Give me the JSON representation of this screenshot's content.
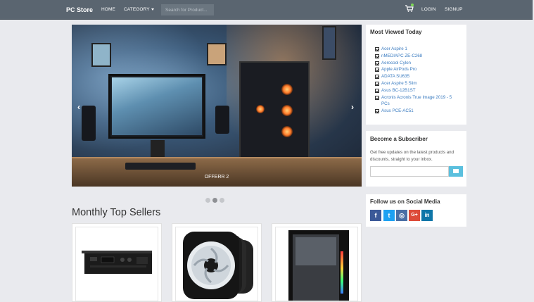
{
  "navbar": {
    "brand": "PC Store",
    "home": "HOME",
    "category": "CATEGORY",
    "search_placeholder": "Search for Product...",
    "login": "LOGIN",
    "signup": "SIGNUP",
    "cart_icon": "cart-icon"
  },
  "carousel": {
    "caption": "OFFERR 2",
    "prev_icon": "chevron-left-icon",
    "next_icon": "chevron-right-icon",
    "slides": 3,
    "active_slide": 2
  },
  "most_viewed": {
    "title": "Most Viewed Today",
    "items": [
      "Acer Aspire 1",
      "nMEDIAPC ZE-C268",
      "Aerocool Cylon",
      "Apple AirPods Pro",
      "ADATA SU635",
      "Acer Aspire 5 Slim",
      "Asus BC-12B1ST",
      "Acronis Acronis True Image 2019 - 5",
      "PCs",
      "Asus PCE-AC51"
    ]
  },
  "subscriber": {
    "title": "Become a Subscriber",
    "text": "Get free updates on the latest products and discounts, straight to your inbox.",
    "button_icon": "envelope-icon"
  },
  "social": {
    "title": "Follow us on Social Media",
    "icons": [
      {
        "name": "facebook-icon",
        "glyph": "f",
        "color": "#3b5998"
      },
      {
        "name": "twitter-icon",
        "glyph": "t",
        "color": "#1da1f2"
      },
      {
        "name": "instagram-icon",
        "glyph": "◎",
        "color": "#4a6fa5"
      },
      {
        "name": "google-plus-icon",
        "glyph": "G+",
        "color": "#dd4b39"
      },
      {
        "name": "linkedin-icon",
        "glyph": "in",
        "color": "#0e76a8"
      }
    ]
  },
  "monthly": {
    "title": "Monthly Top Sellers"
  },
  "colors": {
    "navbar": "#5a6570",
    "background": "#e9eaee",
    "link": "#3a7bc0",
    "subscribe_button": "#5bc0de"
  }
}
